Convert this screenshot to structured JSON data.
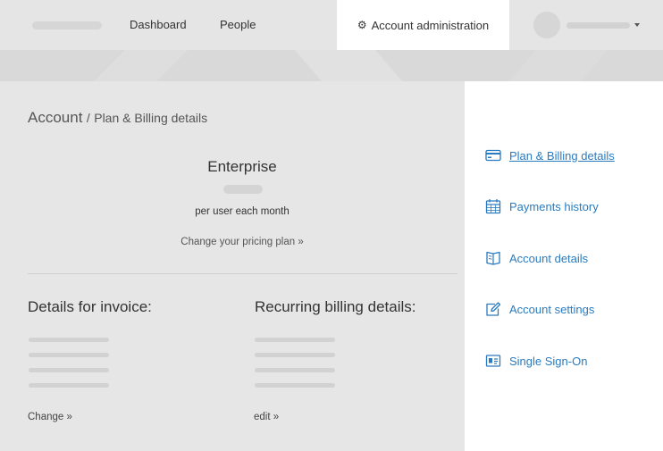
{
  "header": {
    "nav": {
      "dashboard": "Dashboard",
      "people": "People",
      "account_admin": "Account administration"
    }
  },
  "breadcrumb": {
    "root": "Account",
    "separator": "/",
    "current": "Plan & Billing details"
  },
  "plan": {
    "name": "Enterprise",
    "price_unit": "per user each month",
    "change_link": "Change your pricing plan »"
  },
  "invoice": {
    "title": "Details for invoice:",
    "link": "Change »"
  },
  "recurring": {
    "title": "Recurring billing details:",
    "link": "edit »"
  },
  "sidebar": {
    "items": [
      {
        "label": "Plan & Billing details",
        "icon": "credit-card-icon",
        "active": true
      },
      {
        "label": "Payments history",
        "icon": "calendar-icon",
        "active": false
      },
      {
        "label": "Account details",
        "icon": "book-icon",
        "active": false
      },
      {
        "label": "Account settings",
        "icon": "edit-icon",
        "active": false
      },
      {
        "label": "Single Sign-On",
        "icon": "id-card-icon",
        "active": false
      }
    ]
  },
  "colors": {
    "link_blue": "#2a7bbf",
    "page_bg": "#e6e6e6",
    "active_tab_bg": "#ffffff"
  }
}
